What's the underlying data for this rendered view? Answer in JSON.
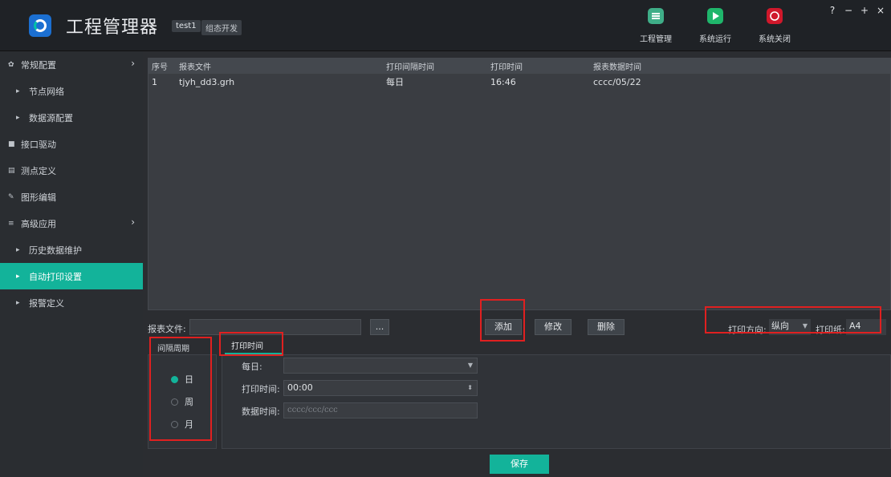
{
  "header": {
    "app_title": "工程管理器",
    "project_name": "test1",
    "project_mode": "组态开发",
    "tools": [
      {
        "label": "工程管理",
        "icon": "list-icon",
        "color": "#3fae88"
      },
      {
        "label": "系统运行",
        "icon": "play-icon",
        "color": "#1fb66b"
      },
      {
        "label": "系统关闭",
        "icon": "power-icon",
        "color": "#d0182b"
      }
    ],
    "window_controls": [
      "?",
      "−",
      "+",
      "×"
    ]
  },
  "sidebar": {
    "items": [
      {
        "label": "常规配置",
        "icon": "gear-icon",
        "level": 0,
        "expandable": true
      },
      {
        "label": "节点网络",
        "level": 1
      },
      {
        "label": "数据源配置",
        "level": 1
      },
      {
        "label": "接口驱动",
        "icon": "plug-icon",
        "level": 0
      },
      {
        "label": "测点定义",
        "icon": "database-icon",
        "level": 0
      },
      {
        "label": "图形编辑",
        "icon": "edit-icon",
        "level": 0
      },
      {
        "label": "高级应用",
        "icon": "sliders-icon",
        "level": 0,
        "expandable": true
      },
      {
        "label": "历史数据维护",
        "level": 1
      },
      {
        "label": "自动打印设置",
        "level": 1,
        "active": true
      },
      {
        "label": "报警定义",
        "level": 1
      }
    ]
  },
  "table": {
    "headers": [
      "序号",
      "报表文件",
      "打印间隔时间",
      "打印时间",
      "报表数据时间"
    ],
    "rows": [
      [
        "1",
        "tjyh_dd3.grh",
        "每日",
        "16:46",
        "cccc/05/22"
      ]
    ]
  },
  "form": {
    "file_label": "报表文件:",
    "file_value": "",
    "browse_label": "...",
    "add_label": "添加",
    "edit_label": "修改",
    "delete_label": "删除",
    "direction_label": "打印方向:",
    "direction_value": "纵向",
    "paper_label": "打印纸:",
    "paper_value": "A4"
  },
  "config": {
    "period_title": "间隔周期",
    "period_options": [
      {
        "label": "日",
        "selected": true
      },
      {
        "label": "周",
        "selected": false
      },
      {
        "label": "月",
        "selected": false
      }
    ],
    "time_tab": "打印时间",
    "daily_label": "每日:",
    "daily_value": "",
    "print_time_label": "打印时间:",
    "print_time_value": "00:00",
    "data_time_label": "数据时间:",
    "data_time_placeholder": "cccc/ccc/ccc"
  },
  "save_label": "保存",
  "colors": {
    "accent": "#13b39a",
    "highlight": "#e02020"
  }
}
